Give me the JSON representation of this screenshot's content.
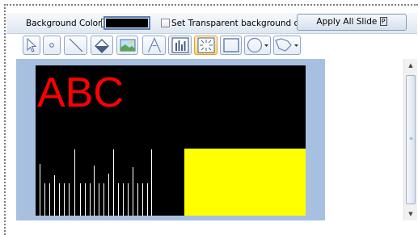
{
  "toolbar": {
    "background_color_label": "Background Color",
    "background_color_hotkey": "B",
    "background_color_suffix": ":",
    "background_color_value": "#000000",
    "transparent_label": "Set Transparent background color",
    "transparent_hotkey": "T",
    "transparent_checked": false,
    "apply_all_label": "Apply All Slide",
    "apply_all_hotkey": "P"
  },
  "tools": [
    {
      "name": "pointer-icon",
      "selected": false
    },
    {
      "name": "dot-icon",
      "selected": false
    },
    {
      "name": "line-icon",
      "selected": false
    },
    {
      "name": "fill-bucket-icon",
      "selected": false
    },
    {
      "name": "image-icon",
      "selected": false
    },
    {
      "name": "text-icon",
      "selected": false
    },
    {
      "name": "equalizer-icon",
      "selected": false
    },
    {
      "name": "sparkle-icon",
      "selected": true
    },
    {
      "name": "rectangle-icon",
      "selected": false
    },
    {
      "name": "ellipse-dropdown-icon",
      "selected": false
    },
    {
      "name": "polygon-dropdown-icon",
      "selected": false
    }
  ],
  "slide": {
    "background": "#000000",
    "text": "ABC",
    "text_color": "#ff0000",
    "rect_color": "#ffff00",
    "panel_color": "#a8c0e0"
  }
}
